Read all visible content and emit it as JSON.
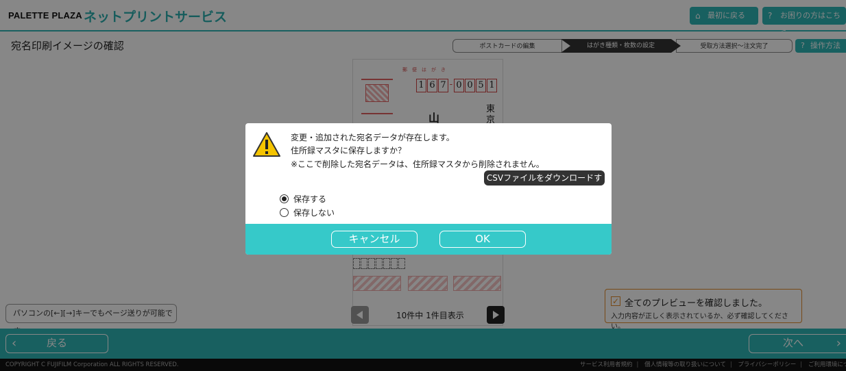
{
  "header": {
    "brand": "PALETTE PLAZA",
    "service": "ネットプリントサービス",
    "home_label": "最初に戻る",
    "help_label": "お困りの方はこちら"
  },
  "page": {
    "title": "宛名印刷イメージの確認",
    "steps": [
      "ポストカードの編集",
      "はがき種類・枚数の設定",
      "受取方法選択〜注文完了"
    ],
    "howto_label": "操作方法"
  },
  "postcard": {
    "postal_label": "郵便はがき",
    "postal_code": [
      "1",
      "6",
      "7",
      "0",
      "0",
      "5",
      "1"
    ],
    "name_char": "山",
    "address_chars": [
      "東",
      "京"
    ]
  },
  "bottom": {
    "hint": "パソコンの[←][→]キーでもページ送りが可能です。",
    "pager_text": "10件中 1件目表示",
    "confirm_title": "全てのプレビューを確認しました。",
    "confirm_sub": "入力内容が正しく表示されているか、必ず確認してください。",
    "confirm_check": "✓"
  },
  "nav": {
    "back_label": "戻る",
    "next_label": "次へ"
  },
  "footer": {
    "copyright": "COPYRIGHT C FUJIFILM Corporation ALL RIGHTS RESERVED.",
    "links": [
      "サービス利用者規約",
      "個人情報等の取り扱いについて",
      "プライバシーポリシー",
      "ご利用環境につい"
    ]
  },
  "dialog": {
    "message_lines": [
      "変更・追加された宛名データが存在します。",
      "住所録マスタに保存しますか？",
      "※ここで削除した宛名データは、住所録マスタから削除されません。"
    ],
    "csv_label": "CSVファイルをダウンロードする",
    "options": [
      {
        "label": "保存する",
        "selected": true
      },
      {
        "label": "保存しない",
        "selected": false
      }
    ],
    "cancel_label": "キャンセル",
    "ok_label": "OK"
  },
  "colors": {
    "accent": "#2fb6b6",
    "dialog_footer": "#36c9c9",
    "warning": "#f5c400"
  }
}
